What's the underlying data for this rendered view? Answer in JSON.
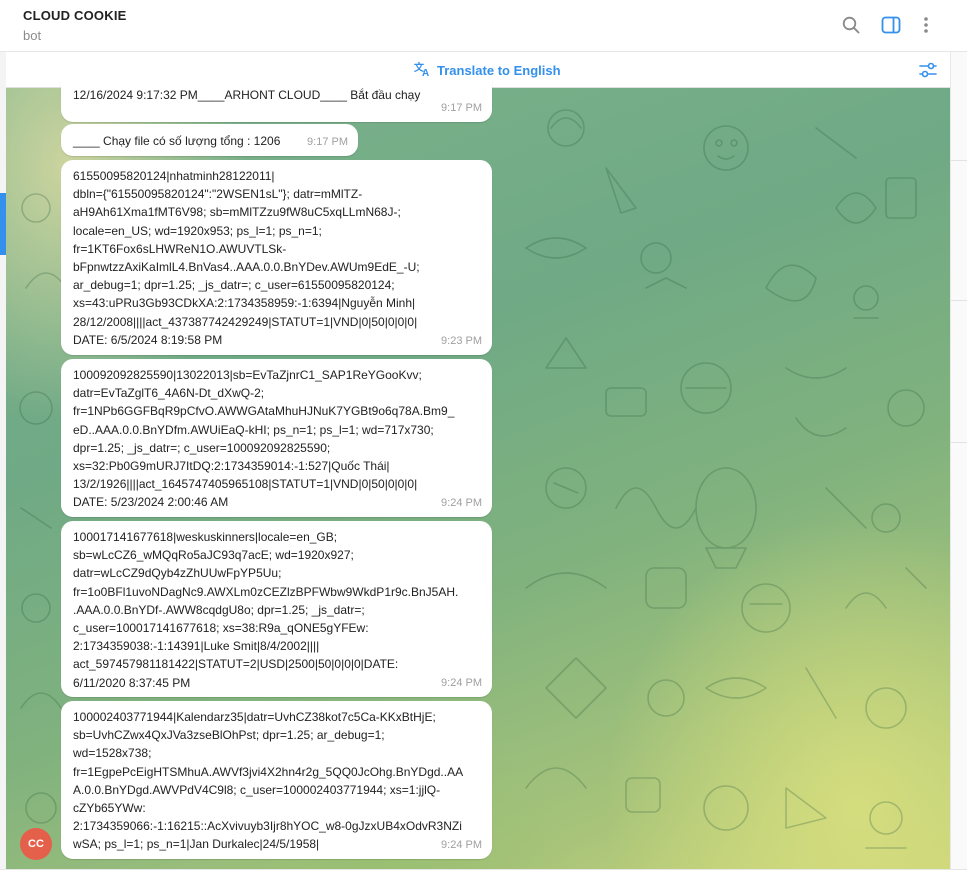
{
  "header": {
    "title": "CLOUD COOKIE",
    "subtitle": "bot",
    "icons": [
      "search-icon",
      "sidebar-toggle-icon",
      "more-vertical-icon"
    ]
  },
  "translate_bar": {
    "label": "Translate to English",
    "icon": "translate-icon",
    "settings_icon": "filter-settings-icon"
  },
  "colors": {
    "accent": "#3390ec",
    "avatar": "#e5604a"
  },
  "avatar": {
    "initials": "CC"
  },
  "messages": [
    {
      "text": "12/16/2024 9:17:32 PM____ARHONT CLOUD____ Bắt đầu chạy",
      "time": "9:17 PM"
    },
    {
      "text": "____ Chạy file có số lượng tổng : 1206",
      "time": "9:17 PM"
    },
    {
      "text": "61550095820124|nhatminh28122011|\ndbln={\"61550095820124\":\"2WSEN1sL\"}; datr=mMlTZ-\naH9Ah61Xma1fMT6V98; sb=mMlTZzu9fW8uC5xqLLmN68J-;\nlocale=en_US; wd=1920x953; ps_l=1; ps_n=1;\nfr=1KT6Fox6sLHWReN1O.AWUVTLSk-\nbFpnwtzzAxiKaImlL4.BnVas4..AAA.0.0.BnYDev.AWUm9EdE_-U;\nar_debug=1; dpr=1.25; _js_datr=; c_user=61550095820124;\nxs=43:uPRu3Gb93CDkXA:2:1734358959:-1:6394|Nguyễn Minh|\n28/12/2008||||act_437387742429249|STATUT=1|VND|0|50|0|0|0|\nDATE: 6/5/2024 8:19:58 PM",
      "time": "9:23 PM"
    },
    {
      "text": "100092092825590|13022013|sb=EvTaZjnrC1_SAP1ReYGooKvv;\ndatr=EvTaZglT6_4A6N-Dt_dXwQ-2;\nfr=1NPb6GGFBqR9pCfvO.AWWGAtaMhuHJNuK7YGBt9o6q78A.Bm9_\neD..AAA.0.0.BnYDfm.AWUiEaQ-kHI; ps_n=1; ps_l=1; wd=717x730;\ndpr=1.25; _js_datr=; c_user=100092092825590;\nxs=32:Pb0G9mURJ7ItDQ:2:1734359014:-1:527|Quốc Thái|\n13/2/1926||||act_1645747405965108|STATUT=1|VND|0|50|0|0|0|\nDATE: 5/23/2024 2:00:46 AM",
      "time": "9:24 PM"
    },
    {
      "text": "100017141677618|weskuskinners|locale=en_GB;\nsb=wLcCZ6_wMQqRo5aJC93q7acE; wd=1920x927;\ndatr=wLcCZ9dQyb4zZhUUwFpYP5Uu;\nfr=1o0BFl1uvoNDagNc9.AWXLm0zCEZlzBPFWbw9WkdP1r9c.BnJ5AH.\n.AAA.0.0.BnYDf-.AWW8cqdgU8o; dpr=1.25; _js_datr=;\nc_user=100017141677618; xs=38:R9a_qONE5gYFEw:\n2:1734359038:-1:14391|Luke Smit|8/4/2002||||\nact_597457981181422|STATUT=2|USD|2500|50|0|0|0|DATE:\n6/11/2020 8:37:45 PM",
      "time": "9:24 PM"
    },
    {
      "text": "100002403771944|Kalendarz35|datr=UvhCZ38kot7c5Ca-KKxBtHjE;\nsb=UvhCZwx4QxJVa3zseBlOhPst; dpr=1.25; ar_debug=1;\nwd=1528x738;\nfr=1EgpePcEigHTSMhuA.AWVf3jvi4X2hn4r2g_5QQ0JcOhg.BnYDgd..AA\nA.0.0.BnYDgd.AWVPdV4C9l8; c_user=100002403771944; xs=1:jjlQ-\ncZYb65YWw:\n2:1734359066:-1:16215::AcXvivuyb3Ijr8hYOC_w8-0gJzxUB4xOdvR3NZi\nwSA; ps_l=1; ps_n=1|Jan Durkalec|24/5/1958|",
      "time": "9:24 PM"
    }
  ]
}
